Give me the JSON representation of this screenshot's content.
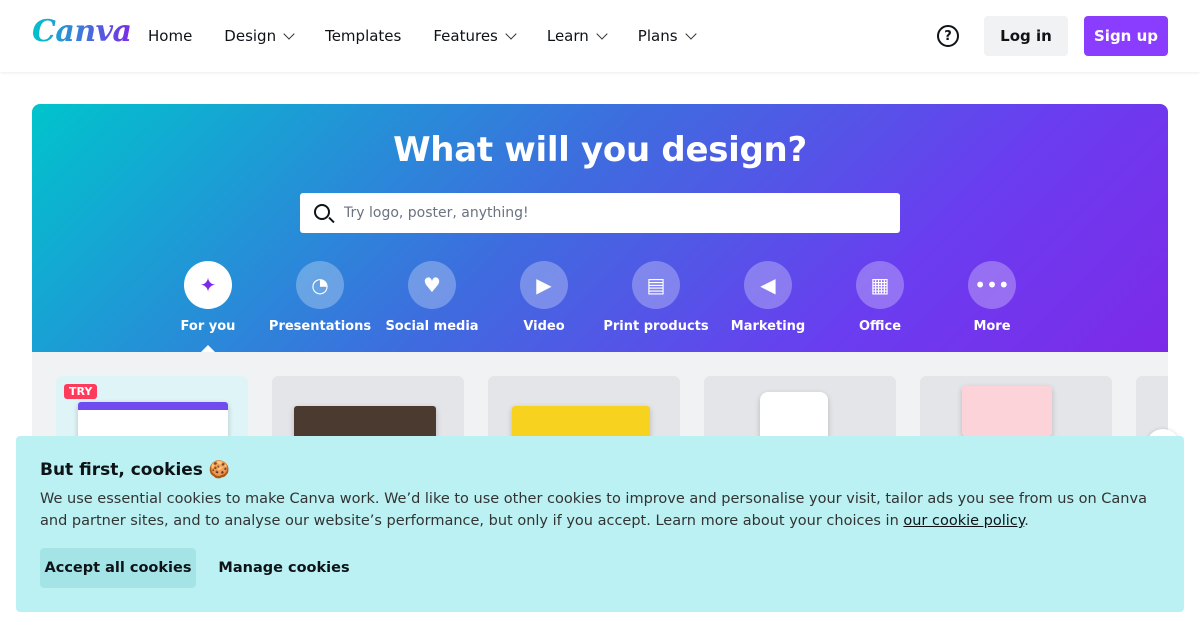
{
  "header": {
    "logo": "Canva",
    "nav": [
      {
        "label": "Home",
        "dropdown": false
      },
      {
        "label": "Design",
        "dropdown": true
      },
      {
        "label": "Templates",
        "dropdown": false
      },
      {
        "label": "Features",
        "dropdown": true
      },
      {
        "label": "Learn",
        "dropdown": true
      },
      {
        "label": "Plans",
        "dropdown": true
      }
    ],
    "help_icon": "?",
    "login_label": "Log in",
    "signup_label": "Sign up"
  },
  "hero": {
    "title": "What will you design?",
    "search_placeholder": "Try logo, poster, anything!",
    "categories": [
      {
        "label": "For you",
        "icon": "sparkle-icon",
        "glyph": "✦",
        "active": true
      },
      {
        "label": "Presentations",
        "icon": "presentation-icon",
        "glyph": "◔",
        "active": false
      },
      {
        "label": "Social media",
        "icon": "heart-icon",
        "glyph": "♥",
        "active": false
      },
      {
        "label": "Video",
        "icon": "video-icon",
        "glyph": "▶",
        "active": false
      },
      {
        "label": "Print products",
        "icon": "printer-icon",
        "glyph": "▤",
        "active": false
      },
      {
        "label": "Marketing",
        "icon": "megaphone-icon",
        "glyph": "◀",
        "active": false
      },
      {
        "label": "Office",
        "icon": "briefcase-icon",
        "glyph": "▦",
        "active": false
      },
      {
        "label": "More",
        "icon": "more-icon",
        "glyph": "•••",
        "active": false
      }
    ]
  },
  "templates": {
    "try_badge": "TRY"
  },
  "cookie": {
    "title": "But first, cookies 🍪",
    "text": "We use essential cookies to make Canva work. We’d like to use other cookies to improve and personalise your visit, tailor ads you see from us on Canva and partner sites, and to analyse our website’s performance, but only if you accept. Learn more about your choices in ",
    "link": "our cookie policy",
    "text_end": ".",
    "accept_label": "Accept all cookies",
    "manage_label": "Manage cookies"
  }
}
